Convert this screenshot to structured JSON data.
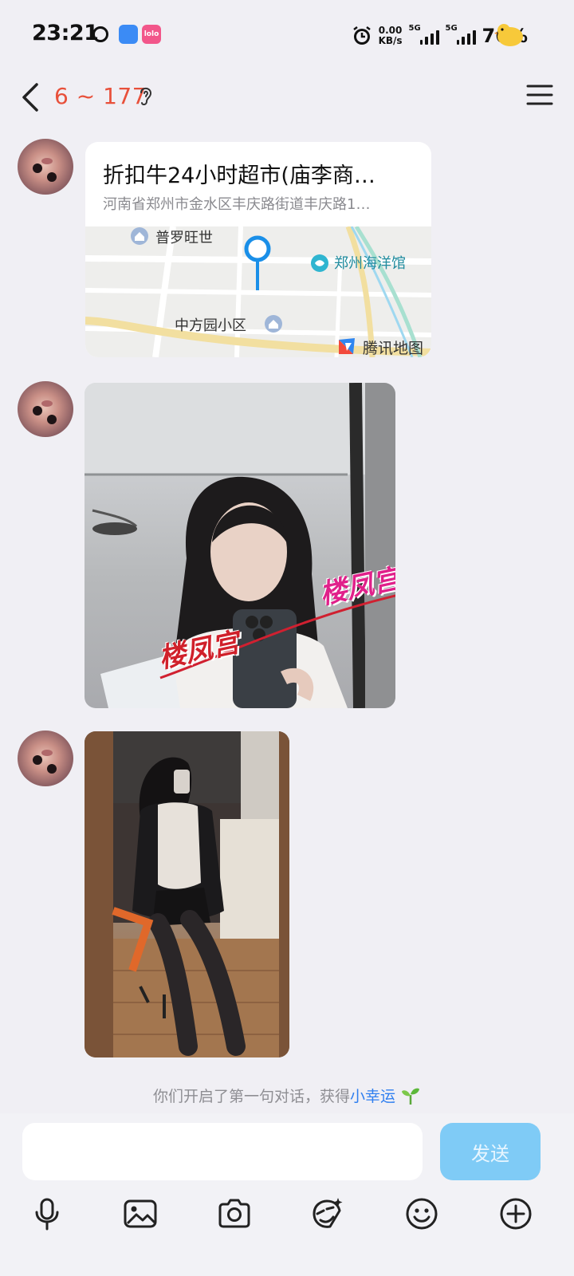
{
  "status_bar": {
    "time": "23:21",
    "net_speed_value": "0.00",
    "net_speed_unit": "KB/s",
    "sim1_label": "5G",
    "sim2_label": "5G",
    "battery": "76%",
    "pink_app_text": "lolo"
  },
  "header": {
    "title": "6 ~ 177"
  },
  "messages": {
    "location": {
      "title": "折扣牛24小时超市(庙李商…",
      "address": "河南省郑州市金水区丰庆路街道丰庆路1…",
      "map_labels": {
        "poi_top": "普罗旺世",
        "poi_right": "郑州海洋馆",
        "poi_bottom": "中方园小区",
        "provider": "腾讯地图"
      }
    },
    "photo1": {
      "watermark_1": "楼凤宫",
      "watermark_2": "楼凤宫"
    }
  },
  "system_note": {
    "prefix": "你们开启了第一句对话，获得",
    "highlight": "小幸运"
  },
  "input": {
    "placeholder": "",
    "send_label": "发送"
  },
  "colors": {
    "title": "#e8503a",
    "send_button": "#7fcbf6",
    "link_blue": "#2f7ff0",
    "background": "#f0eff4"
  },
  "icons": [
    "back-icon",
    "ear-icon",
    "menu-icon",
    "mic-icon",
    "image-icon",
    "camera-icon",
    "sticker-icon",
    "emoji-icon",
    "plus-icon",
    "map-pin-icon",
    "sprout-icon"
  ]
}
